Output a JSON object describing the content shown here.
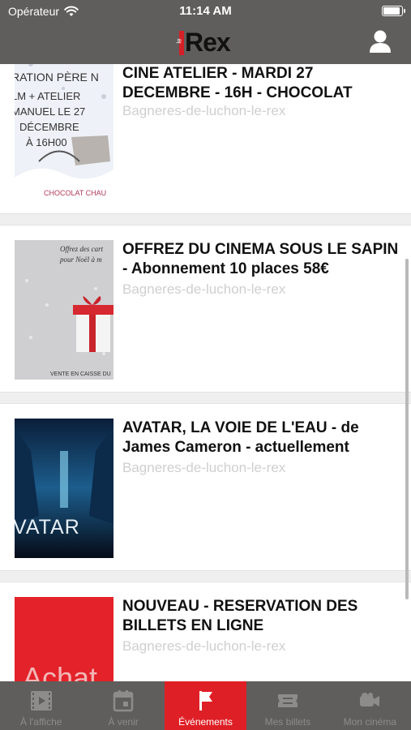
{
  "status_bar": {
    "carrier": "Opérateur",
    "time": "11:14 AM"
  },
  "header": {
    "logo_small": "le",
    "logo_text": "Rex"
  },
  "events": [
    {
      "title": "CINE ATELIER - MARDI 27 DECEMBRE - 16H - CHOCOLAT",
      "venue": "Bagneres-de-luchon-le-rex",
      "thumb_lines": [
        "RATION PÈRE N",
        "LM + ATELIER",
        "MANUEL LE 27",
        "DÉCEMBRE",
        "À 16H00",
        "CHOCOLAT CHAU"
      ]
    },
    {
      "title": "OFFREZ DU CINEMA SOUS LE SAPIN - Abonnement 10 places 58€",
      "venue": "Bagneres-de-luchon-le-rex",
      "thumb_lines": [
        "Offrez des cart",
        "pour Noël à m",
        "VENTE EN CAISSE DU"
      ]
    },
    {
      "title": "AVATAR, LA VOIE DE L'EAU - de James Cameron - actuellement",
      "venue": "Bagneres-de-luchon-le-rex",
      "thumb_lines": [
        "VATAR"
      ]
    },
    {
      "title": "NOUVEAU - RESERVATION DES BILLETS EN LIGNE",
      "venue": "Bagneres-de-luchon-le-rex",
      "thumb_lines": [
        "Achat"
      ]
    }
  ],
  "tabs": [
    {
      "label": "À l'affiche",
      "icon": "film-icon",
      "active": false
    },
    {
      "label": "À venir",
      "icon": "calendar-icon",
      "active": false
    },
    {
      "label": "Événements",
      "icon": "flag-icon",
      "active": true
    },
    {
      "label": "Mes billets",
      "icon": "ticket-icon",
      "active": false
    },
    {
      "label": "Mon cinéma",
      "icon": "camera-icon",
      "active": false
    }
  ],
  "colors": {
    "chrome": "#5f5e5c",
    "accent": "#df1f26",
    "venue_text": "#cfcfcf"
  }
}
